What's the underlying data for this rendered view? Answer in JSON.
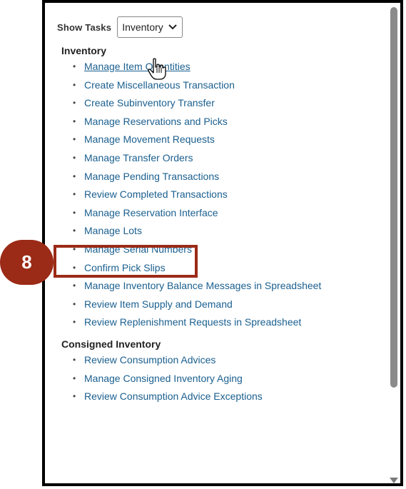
{
  "show_tasks": {
    "label": "Show Tasks",
    "selected": "Inventory"
  },
  "sections": [
    {
      "title": "Inventory",
      "items": [
        "Manage Item Quantities",
        "Create Miscellaneous Transaction",
        "Create Subinventory Transfer",
        "Manage Reservations and Picks",
        "Manage Movement Requests",
        "Manage Transfer Orders",
        "Manage Pending Transactions",
        "Review Completed Transactions",
        "Manage Reservation Interface",
        "Manage Lots",
        "Manage Serial Numbers",
        "Confirm Pick Slips",
        "Manage Inventory Balance Messages in Spreadsheet",
        "Review Item Supply and Demand",
        "Review Replenishment Requests in Spreadsheet"
      ]
    },
    {
      "title": "Consigned Inventory",
      "items": [
        "Review Consumption Advices",
        "Manage Consigned Inventory Aging",
        "Review Consumption Advice Exceptions"
      ]
    }
  ],
  "callout": {
    "step": "8"
  },
  "icons": {
    "dropdown": "chevron-down-icon",
    "cursor": "hand-pointer-icon"
  },
  "colors": {
    "link": "#1a5f8f",
    "callout": "#9b2a16"
  }
}
